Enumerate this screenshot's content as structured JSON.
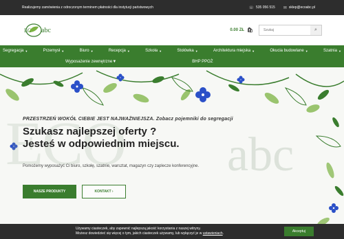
{
  "topbar": {
    "info": "Realizujemy zamówienia z odroczonym terminem płatności dla instytucji państwowych",
    "phone": "535 056 515",
    "email": "sklep@ecoabc.pl"
  },
  "header": {
    "logo_text": "abc",
    "cart_amount": "0.00 ZŁ",
    "search_placeholder": "Szukaj"
  },
  "nav": {
    "row1": [
      {
        "label": "Segregacja",
        "caret": true
      },
      {
        "label": "Przemysł",
        "caret": true
      },
      {
        "label": "Biuro",
        "caret": true
      },
      {
        "label": "Recepcja",
        "caret": true
      },
      {
        "label": "Szkoła",
        "caret": true
      },
      {
        "label": "Stołówka",
        "caret": true
      },
      {
        "label": "Architektura miejska",
        "caret": true
      },
      {
        "label": "Okucia budowlane",
        "caret": true
      },
      {
        "label": "Szatnia",
        "caret": true
      }
    ],
    "row2": [
      {
        "label": "Wyposażenie zewnętrzne",
        "caret": true
      },
      {
        "label": "BHP PPOŻ",
        "caret": false
      }
    ]
  },
  "hero": {
    "watermark": "ECO",
    "watermark_abc": "abc",
    "tagline": "PRZESTRZEŃ WOKÓŁ CIEBIE JEST NAJWAŻNIEJSZA. Zobacz pojemniki do segregacji",
    "headline_line1": "Szukasz najlepszej oferty ?",
    "headline_line2": "Jesteś w odpowiednim miejscu.",
    "subtext": "Pomożemy wyposażyć Ci biuro, szkołę, szatnie, warsztat, magazyn czy zaplecze konferencyjne.",
    "btn_products": "NASZE PRODUKTY",
    "btn_contact": "KONTAKT ›"
  },
  "cookie": {
    "line1": "Używamy ciasteczek, aby zapewnić najlepszą jakość korzystania z naszej witryny.",
    "line2_prefix": "Możesz dowiedzieć się więcej o tym, jakich ciasteczek używamy, lub wyłączyć je w ",
    "line2_link": "ustawieniach",
    "accept_label": "Akceptuj"
  },
  "colors": {
    "brand_green": "#3a7d2e",
    "dark_bar": "#2d2d2d",
    "leaf_blue": "#2b50c8"
  }
}
